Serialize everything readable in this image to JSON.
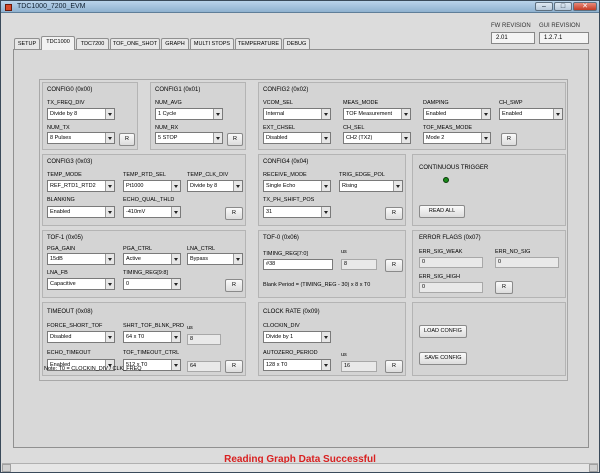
{
  "window": {
    "title": "TDC1000_7200_EVM"
  },
  "revisions": {
    "fw_label": "FW REVISION",
    "fw_value": "2.01",
    "gui_label": "GUI REVISION",
    "gui_value": "1.2.7.1"
  },
  "tabs": [
    "SETUP",
    "TDC1000",
    "TDC7200",
    "TOF_ONE_SHOT",
    "GRAPH",
    "MULTI STOPS",
    "TEMPERATURE",
    "DEBUG"
  ],
  "active_tab": "TDC1000",
  "config0": {
    "title": "CONFIG0 (0x00)",
    "tx_freq_div_label": "TX_FREQ_DIV",
    "tx_freq_div": "Divide by 8",
    "num_tx_label": "NUM_TX",
    "num_tx": "8 Pulses",
    "r": "R"
  },
  "config1": {
    "title": "CONFIG1 (0x01)",
    "num_avg_label": "NUM_AVG",
    "num_avg": "1 Cycle",
    "num_rx_label": "NUM_RX",
    "num_rx": "5 STOP",
    "r": "R"
  },
  "config2": {
    "title": "CONFIG2 (0x02)",
    "vcom_sel_label": "VCOM_SEL",
    "vcom_sel": "Internal",
    "meas_mode_label": "MEAS_MODE",
    "meas_mode": "TOF Measurement",
    "damping_label": "DAMPING",
    "damping": "Enabled",
    "ch_swp_label": "CH_SWP",
    "ch_swp": "Enabled",
    "ext_chsel_label": "EXT_CHSEL",
    "ext_chsel": "Disabled",
    "ch_sel_label": "CH_SEL",
    "ch_sel": "CH2 (TX2)",
    "tof_meas_mode_label": "TOF_MEAS_MODE",
    "tof_meas_mode": "Mode 2",
    "r": "R"
  },
  "config3": {
    "title": "CONFIG3 (0x03)",
    "temp_mode_label": "TEMP_MODE",
    "temp_mode": "REF_RTD1_RTD2",
    "temp_rtd_sel_label": "TEMP_RTD_SEL",
    "temp_rtd_sel": "Pt1000",
    "temp_clk_div_label": "TEMP_CLK_DIV",
    "temp_clk_div": "Divide by 8",
    "blanking_label": "BLANKING",
    "blanking": "Enabled",
    "echo_qual_thld_label": "ECHO_QUAL_THLD",
    "echo_qual_thld": "-410mV",
    "r": "R"
  },
  "config4": {
    "title": "CONFIG4 (0x04)",
    "receive_mode_label": "RECEIVE_MODE",
    "receive_mode": "Single Echo",
    "trig_edge_pol_label": "TRIG_EDGE_POL",
    "trig_edge_pol": "Rising",
    "tx_ph_shift_pos_label": "TX_PH_SHIFT_POS",
    "tx_ph_shift_pos": "31",
    "r": "R"
  },
  "trigger": {
    "title": "CONTINUOUS TRIGGER",
    "read_all": "READ ALL"
  },
  "tof1": {
    "title": "TOF-1 (0x05)",
    "pga_gain_label": "PGA_GAIN",
    "pga_gain": "15dB",
    "pga_ctrl_label": "PGA_CTRL",
    "pga_ctrl": "Active",
    "lna_ctrl_label": "LNA_CTRL",
    "lna_ctrl": "Bypass",
    "lna_fb_label": "LNA_FB",
    "lna_fb": "Capacitive",
    "timing_reg_98_label": "TIMING_REG[9:8]",
    "timing_reg_98": "0",
    "r": "R"
  },
  "tof0": {
    "title": "TOF-0 (0x06)",
    "timing_reg_70_label": "TIMING_REG[7:0]",
    "timing_reg_70": "38",
    "us_label": "us",
    "us_value": "8",
    "blank_period": "Blank Period = (TIMING_REG - 30) x 8 x T0",
    "r": "R"
  },
  "error_flags": {
    "title": "ERROR FLAGS (0x07)",
    "err_sig_weak_label": "ERR_SIG_WEAK",
    "err_sig_weak": "0",
    "err_no_sig_label": "ERR_NO_SIG",
    "err_no_sig": "0",
    "err_sig_high_label": "ERR_SIG_HIGH",
    "err_sig_high": "0",
    "r": "R"
  },
  "timeout": {
    "title": "TIMEOUT (0x08)",
    "force_short_tof_label": "FORCE_SHORT_TOF",
    "force_short_tof": "Disabled",
    "short_tof_blnk_prd_label": "SHRT_TOF_BLNK_PRD",
    "short_tof_blnk_prd": "64 x T0",
    "us_label": "us",
    "us_value1": "8",
    "echo_timeout_label": "ECHO_TIMEOUT",
    "echo_timeout": "Enabled",
    "tof_timeout_ctrl_label": "TOF_TIMEOUT_CTRL",
    "tof_timeout_ctrl": "512 x T0",
    "us_value2": "64",
    "r": "R"
  },
  "clock_rate": {
    "title": "CLOCK RATE (0x09)",
    "clockin_div_label": "CLOCKIN_DIV",
    "clockin_div": "Divide by 1",
    "autozero_period_label": "AUTOZERO_PERIOD",
    "autozero_period": "128 x T0",
    "us_label": "us",
    "us_value": "16",
    "r": "R"
  },
  "config_buttons": {
    "load": "LOAD CONFIG",
    "save": "SAVE CONFIG"
  },
  "note": "Note: T0 = CLOCKIN_DIV / CLK_FREQ",
  "status": "Reading Graph Data Successful"
}
